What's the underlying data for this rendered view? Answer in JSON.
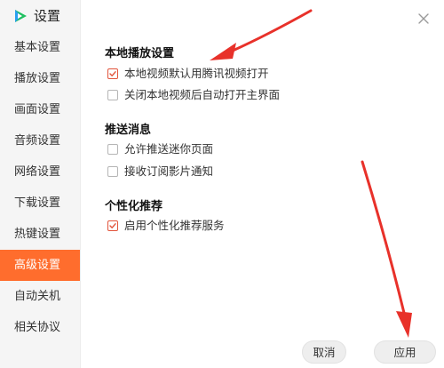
{
  "sidebar": {
    "title": "设置",
    "logo_icon": "tencent-video-logo",
    "items": [
      {
        "label": "基本设置",
        "active": false
      },
      {
        "label": "播放设置",
        "active": false
      },
      {
        "label": "画面设置",
        "active": false
      },
      {
        "label": "音频设置",
        "active": false
      },
      {
        "label": "网络设置",
        "active": false
      },
      {
        "label": "下载设置",
        "active": false
      },
      {
        "label": "热键设置",
        "active": false
      },
      {
        "label": "高级设置",
        "active": true
      },
      {
        "label": "自动关机",
        "active": false
      },
      {
        "label": "相关协议",
        "active": false
      }
    ]
  },
  "window": {
    "close_icon": "close-icon"
  },
  "sections": [
    {
      "title": "本地播放设置",
      "options": [
        {
          "label": "本地视频默认用腾讯视频打开",
          "checked": true
        },
        {
          "label": "关闭本地视频后自动打开主界面",
          "checked": false
        }
      ]
    },
    {
      "title": "推送消息",
      "options": [
        {
          "label": "允许推送迷你页面",
          "checked": false
        },
        {
          "label": "接收订阅影片通知",
          "checked": false
        }
      ]
    },
    {
      "title": "个性化推荐",
      "options": [
        {
          "label": "启用个性化推荐服务",
          "checked": true
        }
      ]
    }
  ],
  "buttons": {
    "cancel_label": "取消",
    "apply_label": "应用"
  },
  "colors": {
    "accent": "#ff6d2d",
    "check": "#e2543b",
    "annotation_arrow": "#e8312a"
  }
}
